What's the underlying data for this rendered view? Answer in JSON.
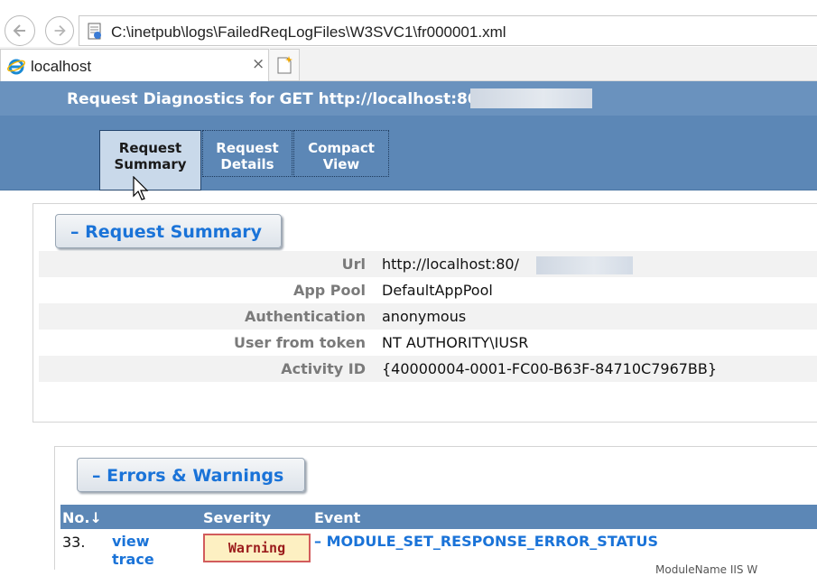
{
  "browser": {
    "address": "C:\\inetpub\\logs\\FailedReqLogFiles\\W3SVC1\\fr000001.xml",
    "tab_title": "localhost",
    "tab_close": "×",
    "icons": [
      "back-icon",
      "forward-icon",
      "document-icon",
      "ie-icon",
      "new-tab-icon"
    ]
  },
  "header": {
    "title": "Request Diagnostics for GET http://localhost:80",
    "tabs": [
      {
        "label": "Request Summary",
        "active": true
      },
      {
        "label": "Request Details",
        "active": false
      },
      {
        "label": "Compact View",
        "active": false
      }
    ]
  },
  "summary": {
    "section_title": "–  Request Summary",
    "rows": [
      {
        "key": "Url",
        "value": "http://localhost:80/"
      },
      {
        "key": "App Pool",
        "value": "DefaultAppPool"
      },
      {
        "key": "Authentication",
        "value": "anonymous"
      },
      {
        "key": "User from token",
        "value": "NT AUTHORITY\\IUSR"
      },
      {
        "key": "Activity ID",
        "value": "{40000004-0001-FC00-B63F-84710C7967BB}"
      }
    ]
  },
  "errors": {
    "section_title": "–  Errors & Warnings",
    "columns": {
      "no": "No.↓",
      "severity": "Severity",
      "event": "Event"
    },
    "rows": [
      {
        "no": "33.",
        "link": "view trace",
        "severity": "Warning",
        "event": "–  MODULE_SET_RESPONSE_ERROR_STATUS",
        "sub": "ModuleName  IIS W"
      }
    ]
  },
  "colors": {
    "header_bg": "#5c87b6",
    "link": "#1a73d8",
    "warning_border": "#d25c5c"
  }
}
